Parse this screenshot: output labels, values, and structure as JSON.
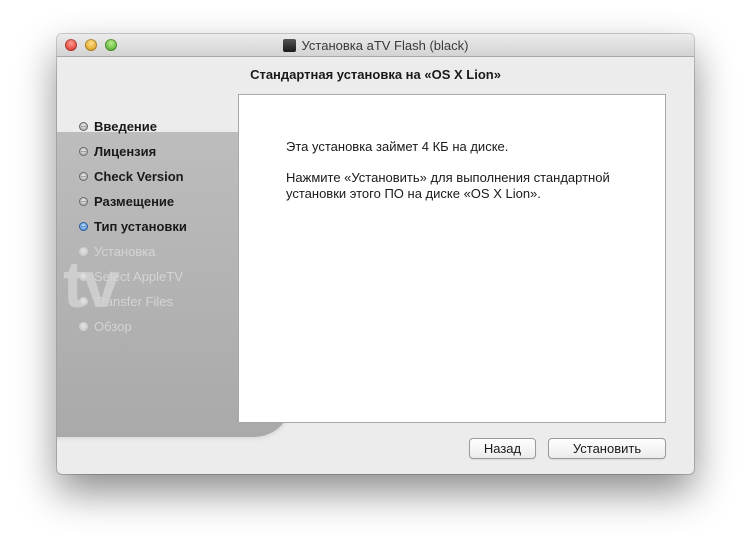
{
  "window": {
    "title": "Установка aTV Flash (black)",
    "app_icon_glyph": ""
  },
  "header": {
    "subtitle": "Стандартная установка на «OS X Lion»"
  },
  "watermark": {
    "text": "tv"
  },
  "sidebar": {
    "steps": [
      {
        "label": "Введение",
        "state": "done"
      },
      {
        "label": "Лицензия",
        "state": "done"
      },
      {
        "label": "Check Version",
        "state": "done"
      },
      {
        "label": "Размещение",
        "state": "done"
      },
      {
        "label": "Тип установки",
        "state": "current"
      },
      {
        "label": "Установка",
        "state": "future"
      },
      {
        "label": "Select AppleTV",
        "state": "future"
      },
      {
        "label": "Transfer Files",
        "state": "future"
      },
      {
        "label": "Обзор",
        "state": "future"
      }
    ]
  },
  "content": {
    "paragraph1": "Эта установка займет 4 КБ на диске.",
    "paragraph2": "Нажмите «Установить» для выполнения стандартной установки этого ПО на диске «OS X Lion»."
  },
  "buttons": {
    "back": "Назад",
    "install": "Установить"
  },
  "colors": {
    "current_step": "#3a84d8",
    "window_bg": "#ececec"
  }
}
